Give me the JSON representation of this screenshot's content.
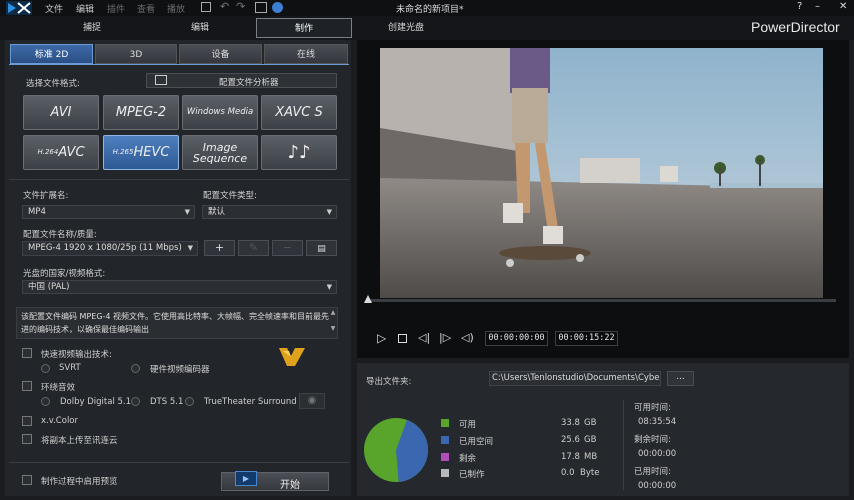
{
  "app": {
    "title": "未命名的新项目*",
    "brand": "PowerDirector",
    "help": "?",
    "min": "–",
    "max": "□",
    "close": "✕"
  },
  "menu": [
    "文件",
    "编辑",
    "插件",
    "查看",
    "播放"
  ],
  "nav_tabs": [
    "捕捉",
    "编辑",
    "制作",
    "创建光盘"
  ],
  "sub_tabs": [
    "标准 2D",
    "3D",
    "设备",
    "在线"
  ],
  "format_label": "选择文件格式:",
  "profile_analyzer": "配置文件分析器",
  "formats": [
    {
      "label": "AVI",
      "sup": ""
    },
    {
      "label": "MPEG-2",
      "sup": ""
    },
    {
      "label": "Windows Media",
      "sup": ""
    },
    {
      "label": "XAVC S",
      "sup": ""
    },
    {
      "label": "AVC",
      "sup": "H.264"
    },
    {
      "label": "HEVC",
      "sup": "H.265"
    },
    {
      "label": "Image Sequence",
      "sup": ""
    },
    {
      "label": "♪♪",
      "sup": ""
    }
  ],
  "settings": {
    "ext_label": "文件扩展名:",
    "ext_value": "MP4",
    "type_label": "配置文件类型:",
    "type_value": "默认",
    "profile_label": "配置文件名称/质量:",
    "profile_value": "MPEG-4 1920 x 1080/25p (11 Mbps)",
    "add": "+",
    "country_label": "光盘的国家/视频格式:",
    "country_value": "中国 (PAL)",
    "description": "该配置文件编码 MPEG-4 视频文件。它使用高比特率、大帧幅、完全帧速率和目前最先进的编码技术，以确保最佳编码输出",
    "fast_label": "快速视频输出技术:",
    "svrt": "SVRT",
    "hw": "硬件视频编码器",
    "surround_label": "环绕音效",
    "dolby": "Dolby Digital 5.1",
    "dts": "DTS 5.1",
    "truetheater": "TrueTheater Surround",
    "xvcolor": "x.v.Color",
    "cloud": "将副本上传至讯连云",
    "preview_label": "制作过程中启用预览",
    "start": "开始"
  },
  "player": {
    "current_time": "00:00:00:00",
    "duration": "00:00:15:22",
    "progress": 0.0
  },
  "export": {
    "folder_label": "导出文件夹:",
    "folder_path": "C:\\Users\\Tenlonstudio\\Documents\\CyberL",
    "browse": "...",
    "legend": [
      {
        "name": "可用",
        "value": "33.8",
        "unit": "GB",
        "color": "#59a52c"
      },
      {
        "name": "已用空间",
        "value": "25.6",
        "unit": "GB",
        "color": "#3a67b0"
      },
      {
        "name": "剩余",
        "value": "17.8",
        "unit": "MB",
        "color": "#b04db8"
      },
      {
        "name": "已制作",
        "value": "0.0",
        "unit": "Byte",
        "color": "#b8b8b8"
      }
    ],
    "avail_time_label": "可用时间:",
    "avail_time": "08:35:54",
    "remain_time_label": "剩余时间:",
    "remain_time": "00:00:00",
    "used_time_label": "已用时间:",
    "used_time": "00:00:00",
    "pie": {
      "available": 33.8,
      "used": 25.6
    }
  }
}
